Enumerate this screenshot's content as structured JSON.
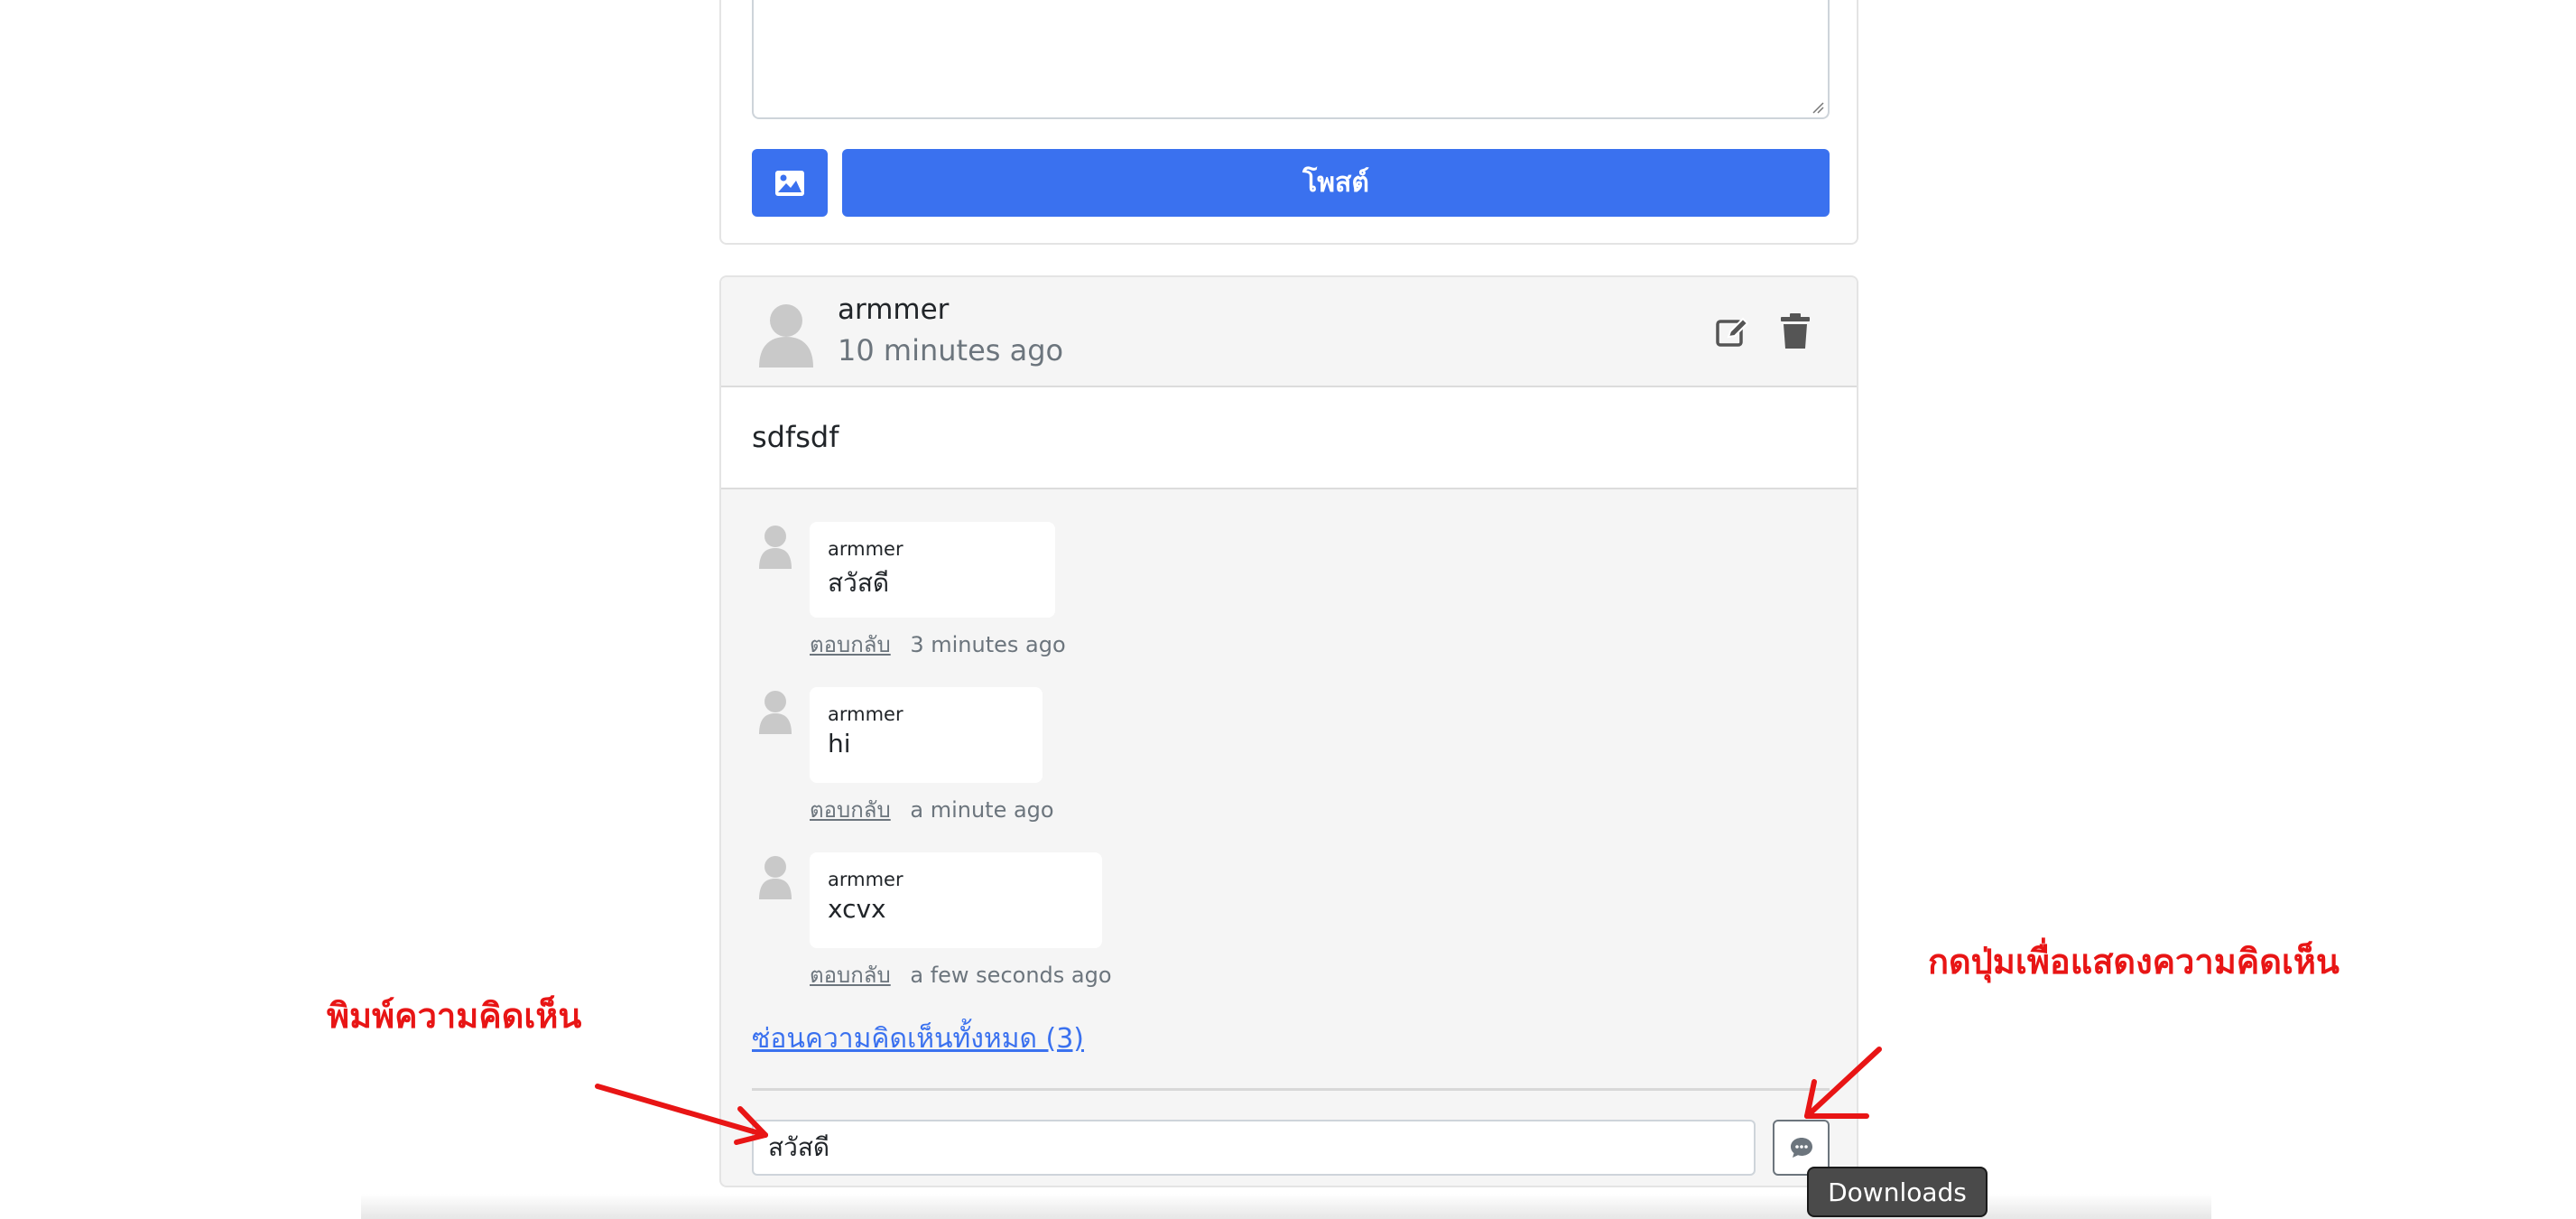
{
  "composer": {
    "post_label": "โพสต์",
    "image_icon": "image-icon"
  },
  "post": {
    "author": "armmer",
    "time": "10 minutes ago",
    "text": "sdfsdf",
    "edit_icon": "edit-icon",
    "delete_icon": "trash-icon"
  },
  "comments": [
    {
      "author": "armmer",
      "text": "สวัสดี",
      "reply_label": "ตอบกลับ",
      "time": "3 minutes ago"
    },
    {
      "author": "armmer",
      "text": "hi",
      "reply_label": "ตอบกลับ",
      "time": "a minute ago"
    },
    {
      "author": "armmer",
      "text": "xcvx",
      "reply_label": "ตอบกลับ",
      "time": "a few seconds ago"
    }
  ],
  "hide_comments_label": "ซ่อนความคิดเห็นทั้งหมด (3)",
  "comment_input": {
    "value": "สวัสดี"
  },
  "send_icon": "chat-icon",
  "annotations": {
    "type_comment": "พิมพ์ความคิดเห็น",
    "press_button": "กดปุ่มเพื่อแสดงความคิดเห็น",
    "color": "#e81515"
  },
  "tooltip": "Downloads",
  "colors": {
    "primary": "#3a71ef",
    "card_bg": "#f5f5f5"
  }
}
